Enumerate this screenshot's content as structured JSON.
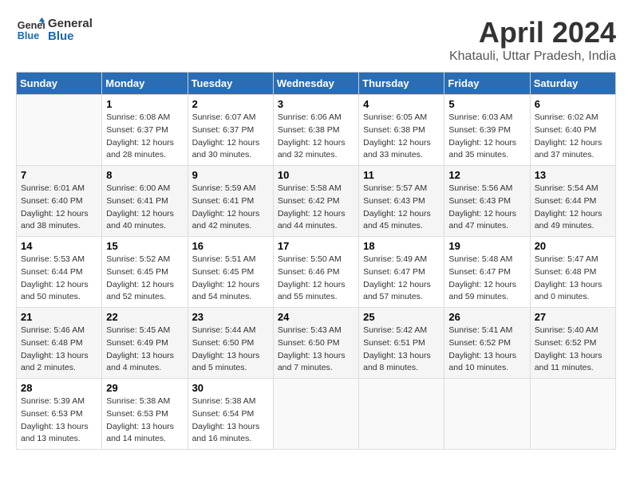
{
  "header": {
    "logo_line1": "General",
    "logo_line2": "Blue",
    "title": "April 2024",
    "subtitle": "Khatauli, Uttar Pradesh, India"
  },
  "weekdays": [
    "Sunday",
    "Monday",
    "Tuesday",
    "Wednesday",
    "Thursday",
    "Friday",
    "Saturday"
  ],
  "weeks": [
    [
      {
        "day": "",
        "detail": ""
      },
      {
        "day": "1",
        "detail": "Sunrise: 6:08 AM\nSunset: 6:37 PM\nDaylight: 12 hours\nand 28 minutes."
      },
      {
        "day": "2",
        "detail": "Sunrise: 6:07 AM\nSunset: 6:37 PM\nDaylight: 12 hours\nand 30 minutes."
      },
      {
        "day": "3",
        "detail": "Sunrise: 6:06 AM\nSunset: 6:38 PM\nDaylight: 12 hours\nand 32 minutes."
      },
      {
        "day": "4",
        "detail": "Sunrise: 6:05 AM\nSunset: 6:38 PM\nDaylight: 12 hours\nand 33 minutes."
      },
      {
        "day": "5",
        "detail": "Sunrise: 6:03 AM\nSunset: 6:39 PM\nDaylight: 12 hours\nand 35 minutes."
      },
      {
        "day": "6",
        "detail": "Sunrise: 6:02 AM\nSunset: 6:40 PM\nDaylight: 12 hours\nand 37 minutes."
      }
    ],
    [
      {
        "day": "7",
        "detail": "Sunrise: 6:01 AM\nSunset: 6:40 PM\nDaylight: 12 hours\nand 38 minutes."
      },
      {
        "day": "8",
        "detail": "Sunrise: 6:00 AM\nSunset: 6:41 PM\nDaylight: 12 hours\nand 40 minutes."
      },
      {
        "day": "9",
        "detail": "Sunrise: 5:59 AM\nSunset: 6:41 PM\nDaylight: 12 hours\nand 42 minutes."
      },
      {
        "day": "10",
        "detail": "Sunrise: 5:58 AM\nSunset: 6:42 PM\nDaylight: 12 hours\nand 44 minutes."
      },
      {
        "day": "11",
        "detail": "Sunrise: 5:57 AM\nSunset: 6:43 PM\nDaylight: 12 hours\nand 45 minutes."
      },
      {
        "day": "12",
        "detail": "Sunrise: 5:56 AM\nSunset: 6:43 PM\nDaylight: 12 hours\nand 47 minutes."
      },
      {
        "day": "13",
        "detail": "Sunrise: 5:54 AM\nSunset: 6:44 PM\nDaylight: 12 hours\nand 49 minutes."
      }
    ],
    [
      {
        "day": "14",
        "detail": "Sunrise: 5:53 AM\nSunset: 6:44 PM\nDaylight: 12 hours\nand 50 minutes."
      },
      {
        "day": "15",
        "detail": "Sunrise: 5:52 AM\nSunset: 6:45 PM\nDaylight: 12 hours\nand 52 minutes."
      },
      {
        "day": "16",
        "detail": "Sunrise: 5:51 AM\nSunset: 6:45 PM\nDaylight: 12 hours\nand 54 minutes."
      },
      {
        "day": "17",
        "detail": "Sunrise: 5:50 AM\nSunset: 6:46 PM\nDaylight: 12 hours\nand 55 minutes."
      },
      {
        "day": "18",
        "detail": "Sunrise: 5:49 AM\nSunset: 6:47 PM\nDaylight: 12 hours\nand 57 minutes."
      },
      {
        "day": "19",
        "detail": "Sunrise: 5:48 AM\nSunset: 6:47 PM\nDaylight: 12 hours\nand 59 minutes."
      },
      {
        "day": "20",
        "detail": "Sunrise: 5:47 AM\nSunset: 6:48 PM\nDaylight: 13 hours\nand 0 minutes."
      }
    ],
    [
      {
        "day": "21",
        "detail": "Sunrise: 5:46 AM\nSunset: 6:48 PM\nDaylight: 13 hours\nand 2 minutes."
      },
      {
        "day": "22",
        "detail": "Sunrise: 5:45 AM\nSunset: 6:49 PM\nDaylight: 13 hours\nand 4 minutes."
      },
      {
        "day": "23",
        "detail": "Sunrise: 5:44 AM\nSunset: 6:50 PM\nDaylight: 13 hours\nand 5 minutes."
      },
      {
        "day": "24",
        "detail": "Sunrise: 5:43 AM\nSunset: 6:50 PM\nDaylight: 13 hours\nand 7 minutes."
      },
      {
        "day": "25",
        "detail": "Sunrise: 5:42 AM\nSunset: 6:51 PM\nDaylight: 13 hours\nand 8 minutes."
      },
      {
        "day": "26",
        "detail": "Sunrise: 5:41 AM\nSunset: 6:52 PM\nDaylight: 13 hours\nand 10 minutes."
      },
      {
        "day": "27",
        "detail": "Sunrise: 5:40 AM\nSunset: 6:52 PM\nDaylight: 13 hours\nand 11 minutes."
      }
    ],
    [
      {
        "day": "28",
        "detail": "Sunrise: 5:39 AM\nSunset: 6:53 PM\nDaylight: 13 hours\nand 13 minutes."
      },
      {
        "day": "29",
        "detail": "Sunrise: 5:38 AM\nSunset: 6:53 PM\nDaylight: 13 hours\nand 14 minutes."
      },
      {
        "day": "30",
        "detail": "Sunrise: 5:38 AM\nSunset: 6:54 PM\nDaylight: 13 hours\nand 16 minutes."
      },
      {
        "day": "",
        "detail": ""
      },
      {
        "day": "",
        "detail": ""
      },
      {
        "day": "",
        "detail": ""
      },
      {
        "day": "",
        "detail": ""
      }
    ]
  ]
}
